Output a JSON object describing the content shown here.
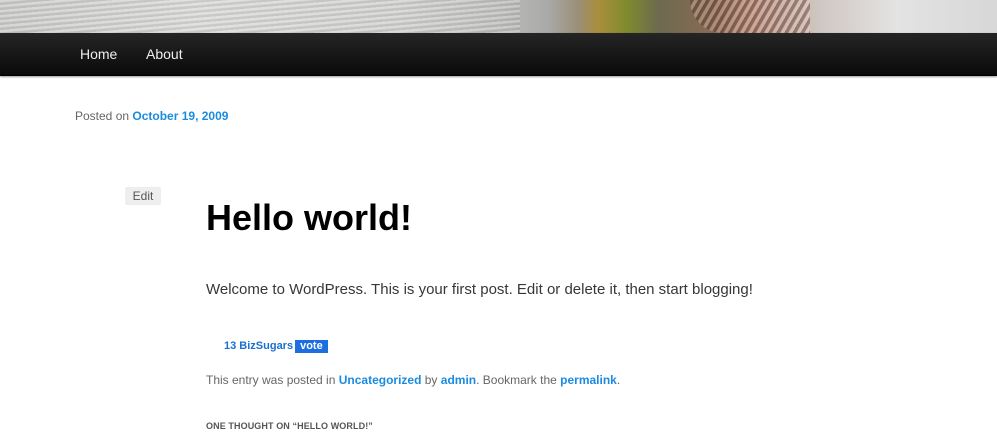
{
  "header": {
    "image_alt": "header image"
  },
  "nav": {
    "items": [
      {
        "label": "Home"
      },
      {
        "label": "About"
      }
    ]
  },
  "post": {
    "posted_prefix": "Posted on ",
    "date": "October 19, 2009",
    "edit_label": "Edit",
    "title": "Hello world!",
    "content": "Welcome to WordPress. This is your first post. Edit or delete it, then start blogging!"
  },
  "bizsugar": {
    "count_label": "13 BizSugars",
    "vote_label": "vote"
  },
  "footer_meta": {
    "prefix": "This entry was posted in ",
    "category": "Uncategorized",
    "by_text": " by ",
    "author": "admin",
    "bookmark_text": ". Bookmark the ",
    "permalink": "permalink",
    "suffix": "."
  },
  "comments": {
    "title": "ONE THOUGHT ON “HELLO WORLD!”"
  },
  "colors": {
    "link": "#1b8be0",
    "nav_bg": "#111111",
    "vote_bg": "#1d6ee0"
  }
}
